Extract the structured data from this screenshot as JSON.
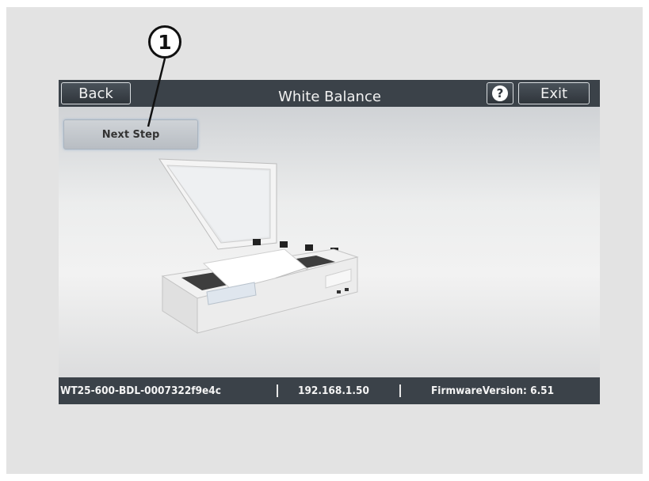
{
  "callout": {
    "number": "1"
  },
  "header": {
    "back_label": "Back",
    "title": "White Balance",
    "help_symbol": "?",
    "exit_label": "Exit"
  },
  "main": {
    "next_step_label": "Next Step"
  },
  "status": {
    "device_id": "WT25-600-BDL-0007322f9e4c",
    "ip_address": "192.168.1.50",
    "firmware": "FirmwareVersion: 6.51"
  },
  "colors": {
    "bar": "#3b4249",
    "next_step_bg": "#c3c8cd",
    "page_bg": "#e3e3e3"
  },
  "icons": {
    "help": "question-circle-icon",
    "scanner": "scanner-illustration"
  }
}
